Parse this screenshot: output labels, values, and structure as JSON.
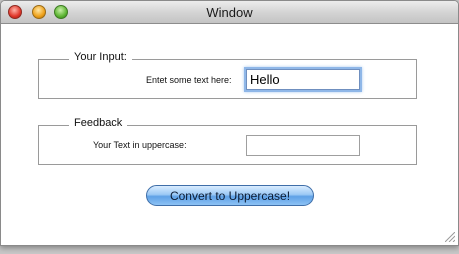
{
  "window": {
    "title": "Window"
  },
  "input_group": {
    "legend": "Your Input:",
    "label": "Entet some text here:",
    "value": "Hello"
  },
  "feedback_group": {
    "legend": "Feedback",
    "label": "Your Text in uppercase:",
    "value": ""
  },
  "button": {
    "label": "Convert to Uppercase!"
  }
}
